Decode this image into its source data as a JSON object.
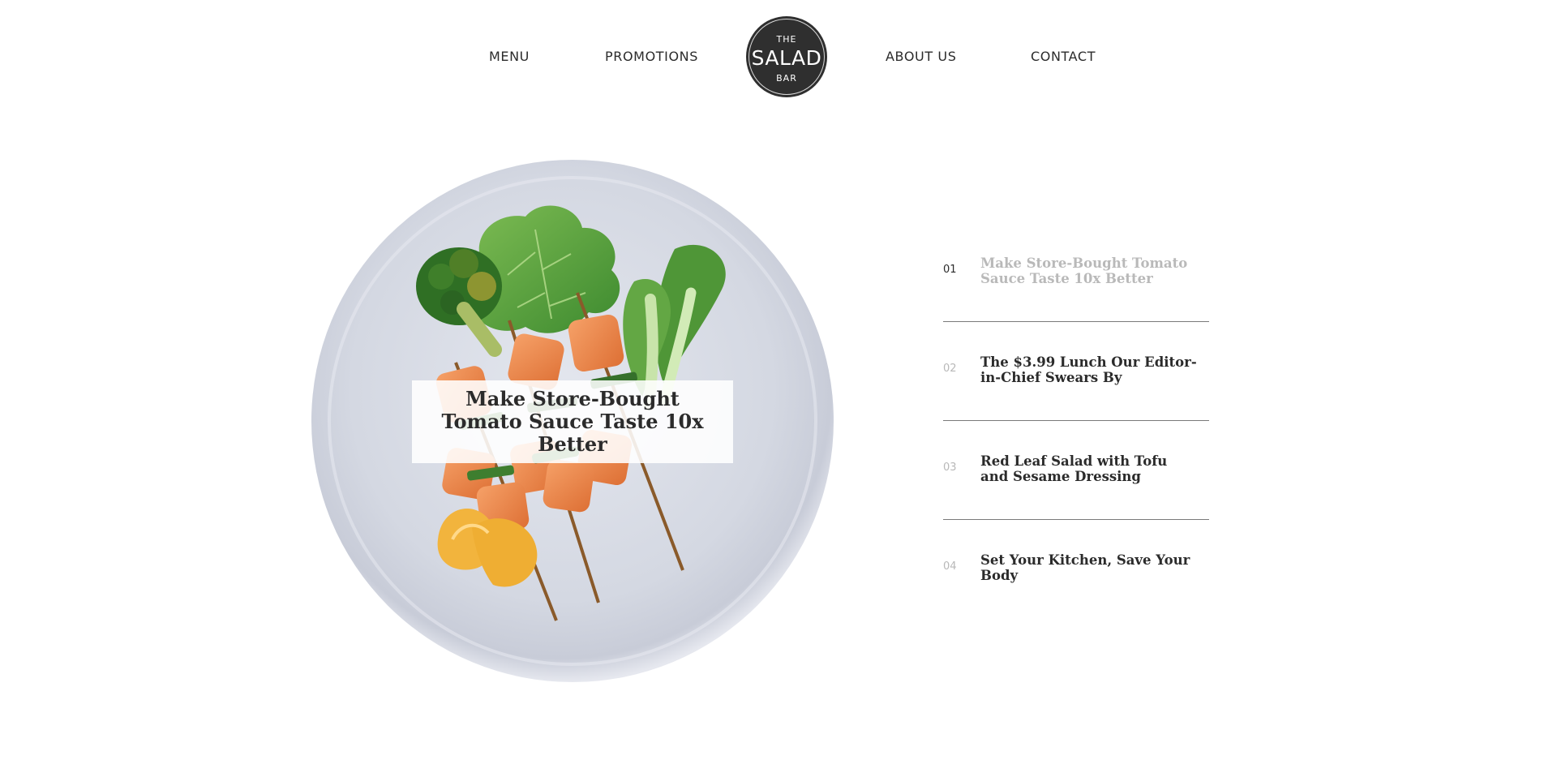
{
  "nav": {
    "items": [
      {
        "label": "MENU"
      },
      {
        "label": "PROMOTIONS"
      },
      {
        "label": "ABOUT US"
      },
      {
        "label": "CONTACT"
      }
    ],
    "logo": {
      "top": "THE",
      "main": "SALAD",
      "bottom": "BAR"
    }
  },
  "featured": {
    "title": "Make Store-Bought Tomato Sauce Taste 10x Better"
  },
  "articles": [
    {
      "number": "01",
      "title": "Make Store-Bought Tomato Sauce Taste 10x Better",
      "active": true
    },
    {
      "number": "02",
      "title": "The $3.99 Lunch Our Editor-in-Chief Swears By",
      "active": false
    },
    {
      "number": "03",
      "title": "Red Leaf Salad with Tofu and Sesame Dressing",
      "active": false
    },
    {
      "number": "04",
      "title": "Set Your Kitchen, Save Your Body",
      "active": false
    }
  ],
  "colors": {
    "text": "#2b2b2b",
    "muted": "#b9b9b9",
    "logo_bg": "#2f2f2f",
    "plate": "#d9dce5"
  }
}
